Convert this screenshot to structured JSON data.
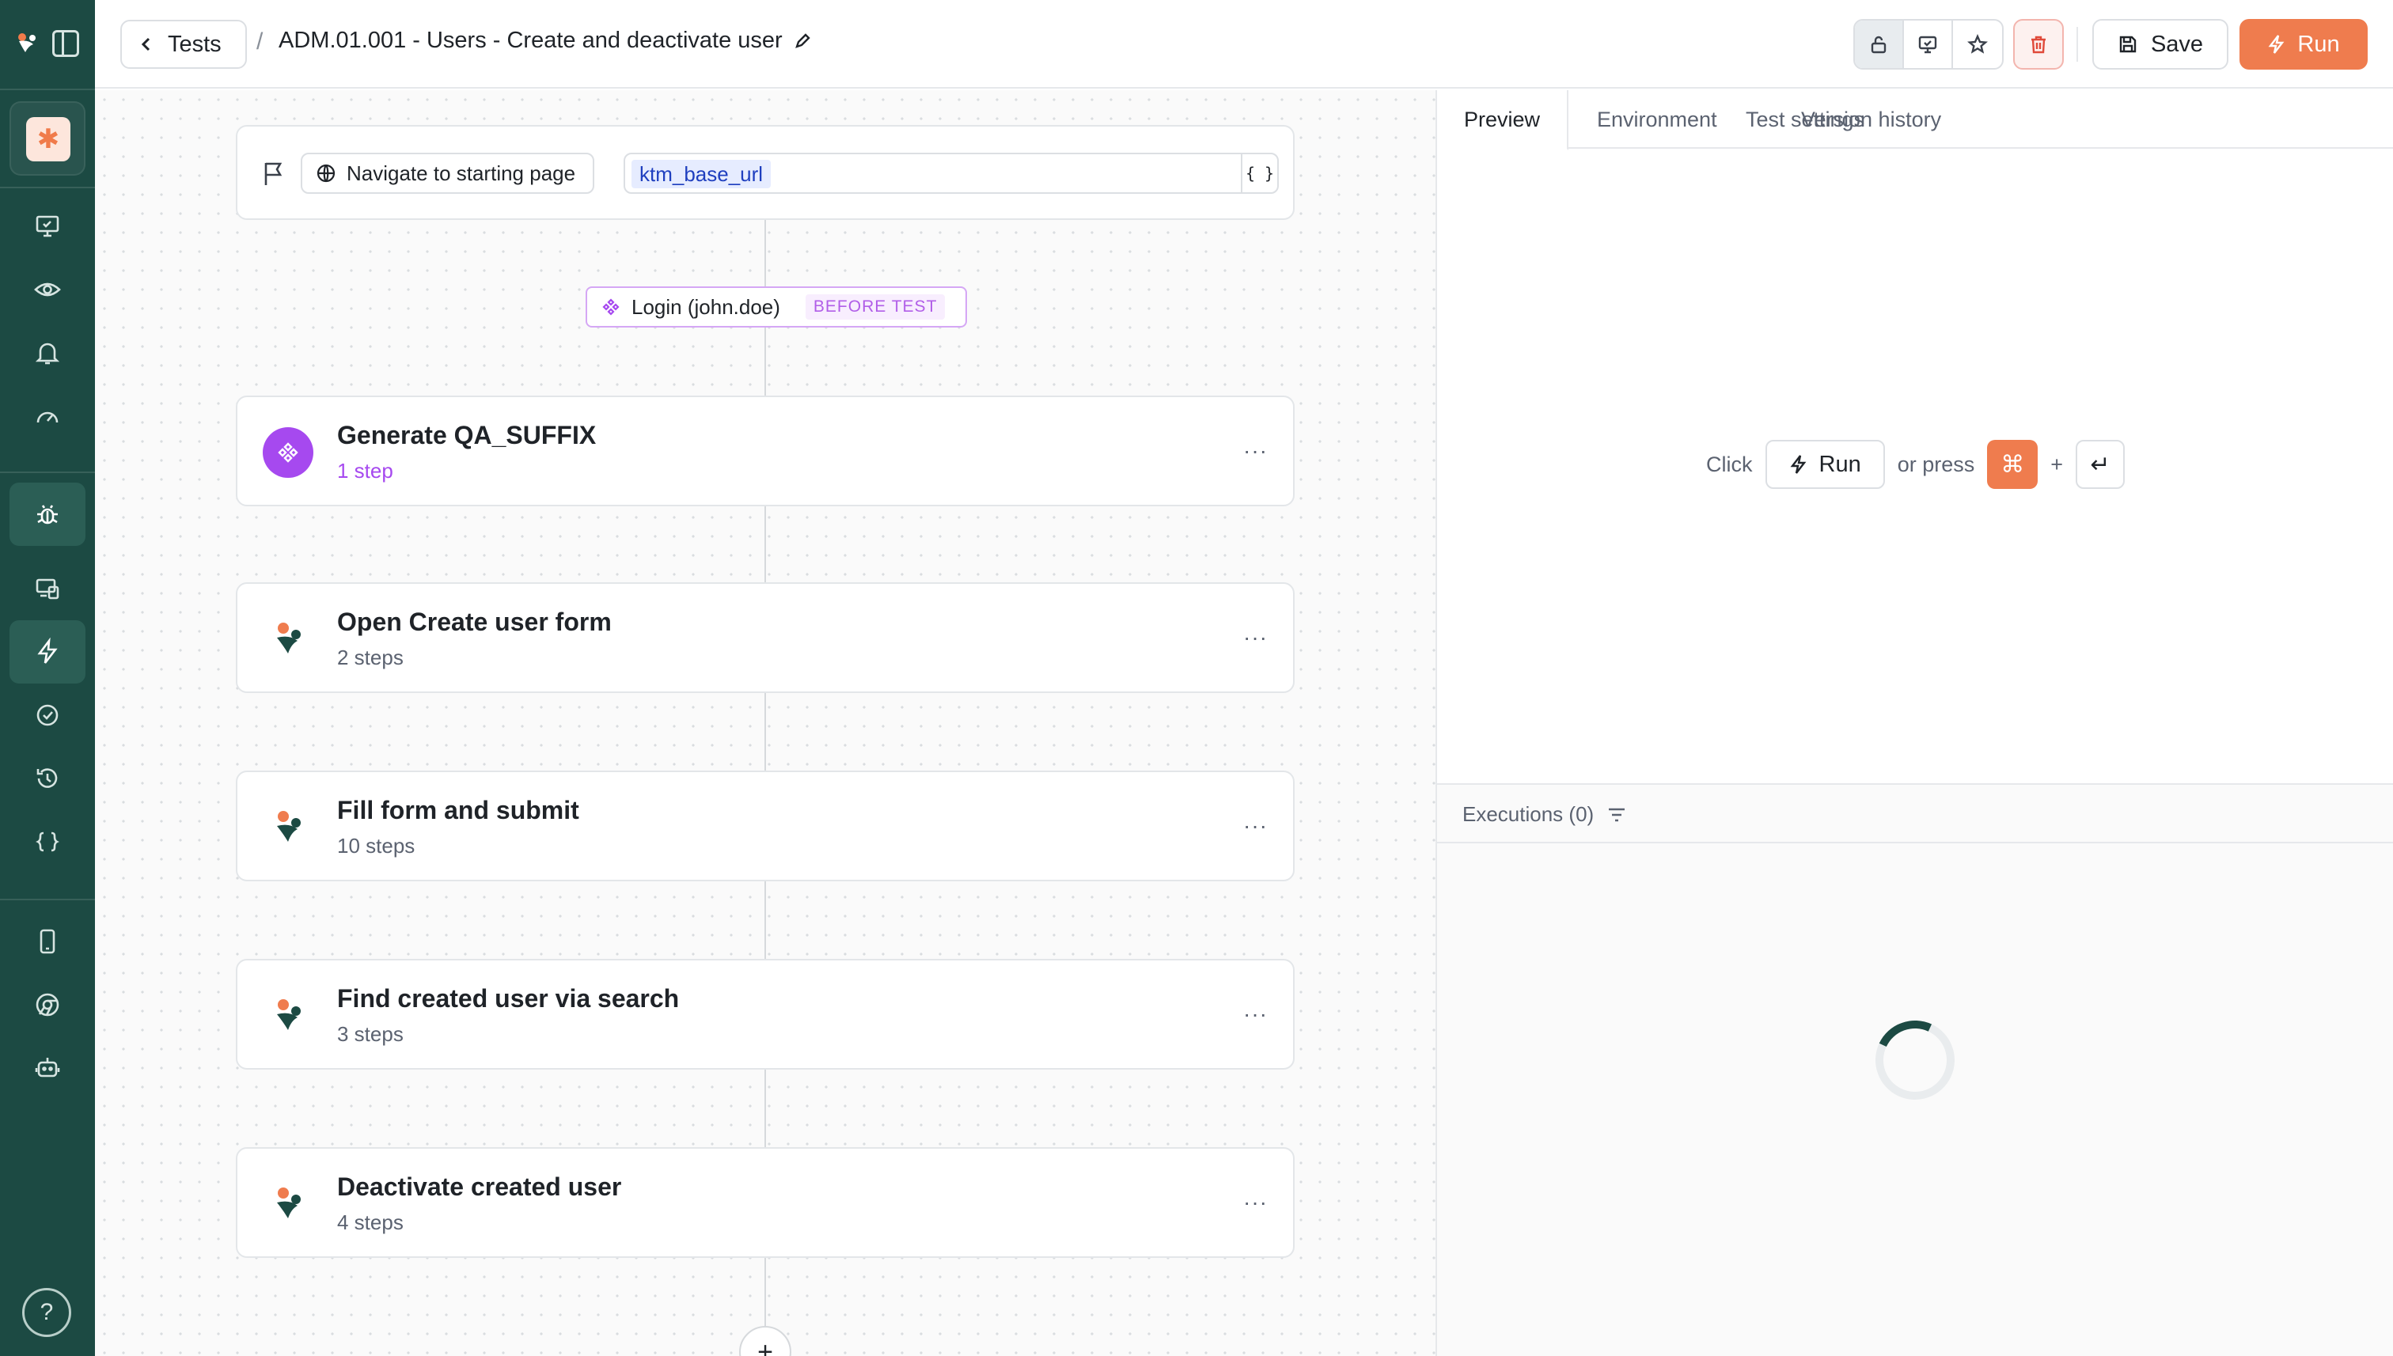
{
  "header": {
    "back_label": "Tests",
    "separator": "/",
    "title": "ADM.01.001 - Users - Create and deactivate user",
    "save_label": "Save",
    "run_label": "Run"
  },
  "canvas": {
    "start": {
      "nav_label": "Navigate to starting page",
      "url_variable": "ktm_base_url",
      "url_button": "{ }"
    },
    "before_test": {
      "label": "Login (john.doe)",
      "tag": "BEFORE TEST"
    },
    "steps": [
      {
        "title": "Generate QA_SUFFIX",
        "subtitle": "1 step"
      },
      {
        "title": "Open Create user form",
        "subtitle": "2 steps"
      },
      {
        "title": "Fill form and submit",
        "subtitle": "10 steps"
      },
      {
        "title": "Find created user via search",
        "subtitle": "3 steps"
      },
      {
        "title": "Deactivate created user",
        "subtitle": "4 steps"
      }
    ],
    "more_label": "···",
    "add_label": "+"
  },
  "panel": {
    "tabs": [
      "Preview",
      "Environment",
      "Test settings",
      "Version history"
    ],
    "hint_click": "Click",
    "hint_run": "Run",
    "hint_or": "or press",
    "hint_cmd": "⌘",
    "hint_plus": "+",
    "hint_enter": "↵",
    "executions_label": "Executions (0)"
  },
  "sidebar": {
    "help_label": "?"
  },
  "colors": {
    "sidebar": "#1c4a43",
    "accent": "#ef7c4e",
    "purple": "#a649ef"
  }
}
